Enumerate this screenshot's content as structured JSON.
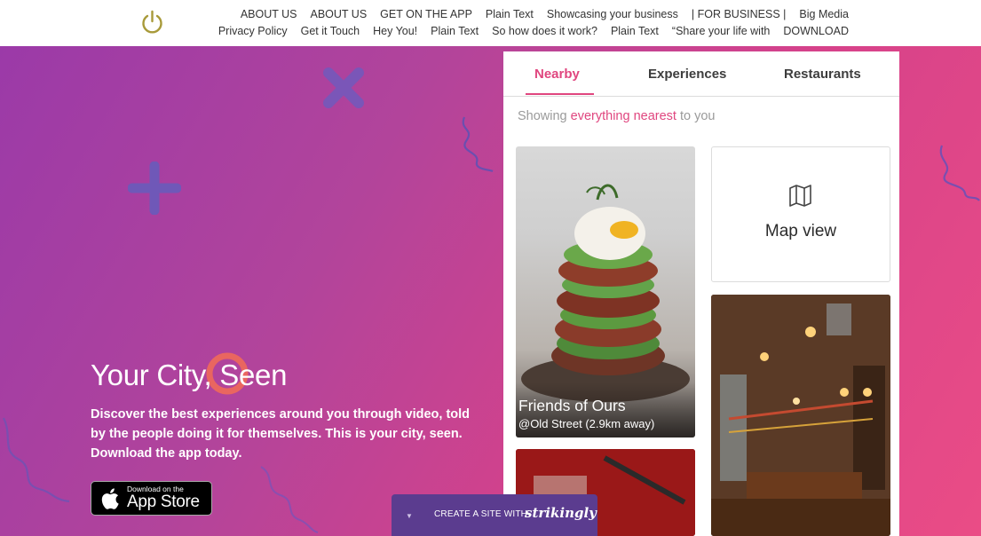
{
  "nav": {
    "row1": [
      "ABOUT US",
      "ABOUT US",
      "GET ON THE APP",
      "Plain Text",
      "Showcasing your business",
      "| FOR BUSINESS |",
      "Big Media"
    ],
    "row2": [
      "Privacy Policy",
      "Get it Touch",
      "Hey You!",
      "Plain Text",
      "So how does it work?",
      "Plain Text",
      "“Share your life with",
      "DOWNLOAD"
    ]
  },
  "hero": {
    "title": "Your City, Seen",
    "description": "Discover the best experiences around you through video, told by the people doing it for themselves. This is your city, seen. Download the app today.",
    "badge_small": "Download on the",
    "badge_big": "App Store"
  },
  "panel": {
    "tabs": [
      "Nearby",
      "Experiences",
      "Restaurants"
    ],
    "showing_prefix": "Showing ",
    "showing_highlight": "everything nearest",
    "showing_suffix": " to you",
    "card1_title": "Friends of Ours",
    "card1_subtitle": "@Old Street (2.9km away)",
    "map_label": "Map view"
  },
  "banner": {
    "text": "CREATE A SITE WITH",
    "brand": "strikingly"
  },
  "colors": {
    "accent": "#e0467f",
    "gradient_start": "#9b3aa8",
    "gradient_end": "#ea4c86",
    "banner": "#5b3c8f"
  }
}
